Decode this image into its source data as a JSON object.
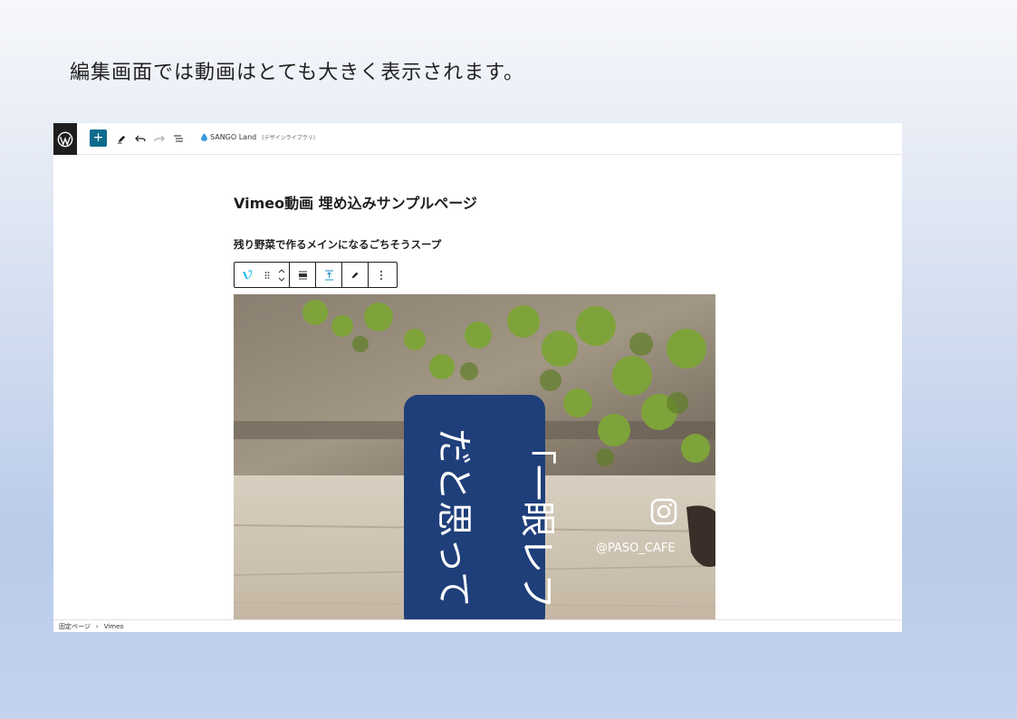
{
  "slide": {
    "caption": "編集画面では動画はとても大きく表示されます。"
  },
  "editor": {
    "site_name": "SANGO Land",
    "site_subtitle": "(デザインライブラリ)",
    "post_title": "Vimeo動画 埋め込みサンプルページ",
    "post_subtitle": "残り野菜で作るメインになるごちそうスープ",
    "add_label": "+",
    "video": {
      "vertical_text_1": "「一眼レフ",
      "vertical_text_2": "だと思って",
      "watermark_handle": "@PASO_CAFE"
    },
    "breadcrumb": {
      "parent": "固定ページ",
      "separator": "›",
      "current": "Vimeo"
    }
  },
  "colors": {
    "accent": "#0e6b8c",
    "vimeo": "#1ab7ea",
    "signboard": "#1f3f7a"
  }
}
